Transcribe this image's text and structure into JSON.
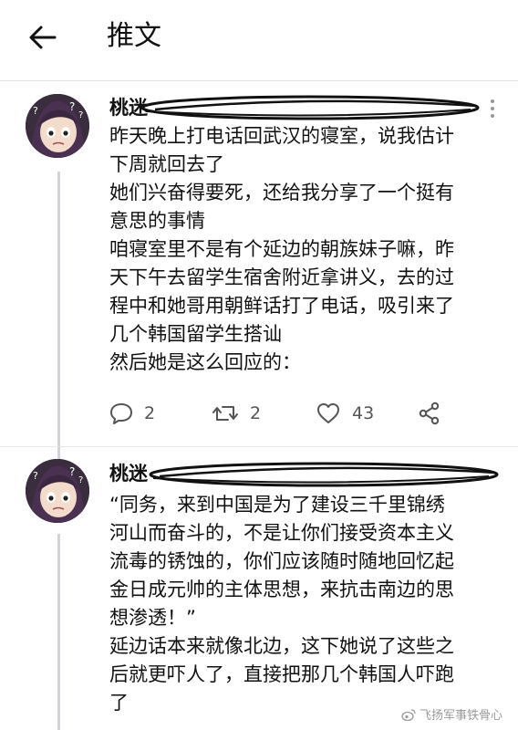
{
  "header": {
    "title": "推文"
  },
  "tweets": [
    {
      "name": "桃迷",
      "handle_partial": "",
      "lines": [
        "昨天晚上打电话回武汉的寝室，说我估计",
        "下周就回去了",
        "她们兴奋得要死，还给我分享了一个挺有",
        "意思的事情",
        "咱寝室里不是有个延边的朝族妹子嘛，昨",
        "天下午去留学生宿舍附近拿讲义，去的过",
        "程中和她哥用朝鲜话打了电话，吸引来了",
        "几个韩国留学生搭讪",
        "然后她是这么回应的："
      ],
      "actions": {
        "replies": "2",
        "retweets": "2",
        "likes": "43"
      }
    },
    {
      "name": "桃迷",
      "handle_partial": "",
      "lines": [
        "“同务，来到中国是为了建设三千里锦绣",
        "河山而奋斗的，不是让你们接受资本主义",
        "流毒的锈蚀的，你们应该随时随地回忆起",
        "金日成元帅的主体思想，来抗击南边的思",
        "想渗透！”",
        "延边话本来就像北边，这下她说了这些之",
        "后就更吓人了，直接把那几个韩国人吓跑",
        "了"
      ]
    }
  ],
  "watermark": {
    "text": "飞扬军事铁骨心"
  },
  "icons": {
    "back": "arrow-left-icon",
    "more": "more-vertical-icon",
    "reply": "comment-icon",
    "retweet": "retweet-icon",
    "like": "heart-icon",
    "share": "share-icon"
  }
}
